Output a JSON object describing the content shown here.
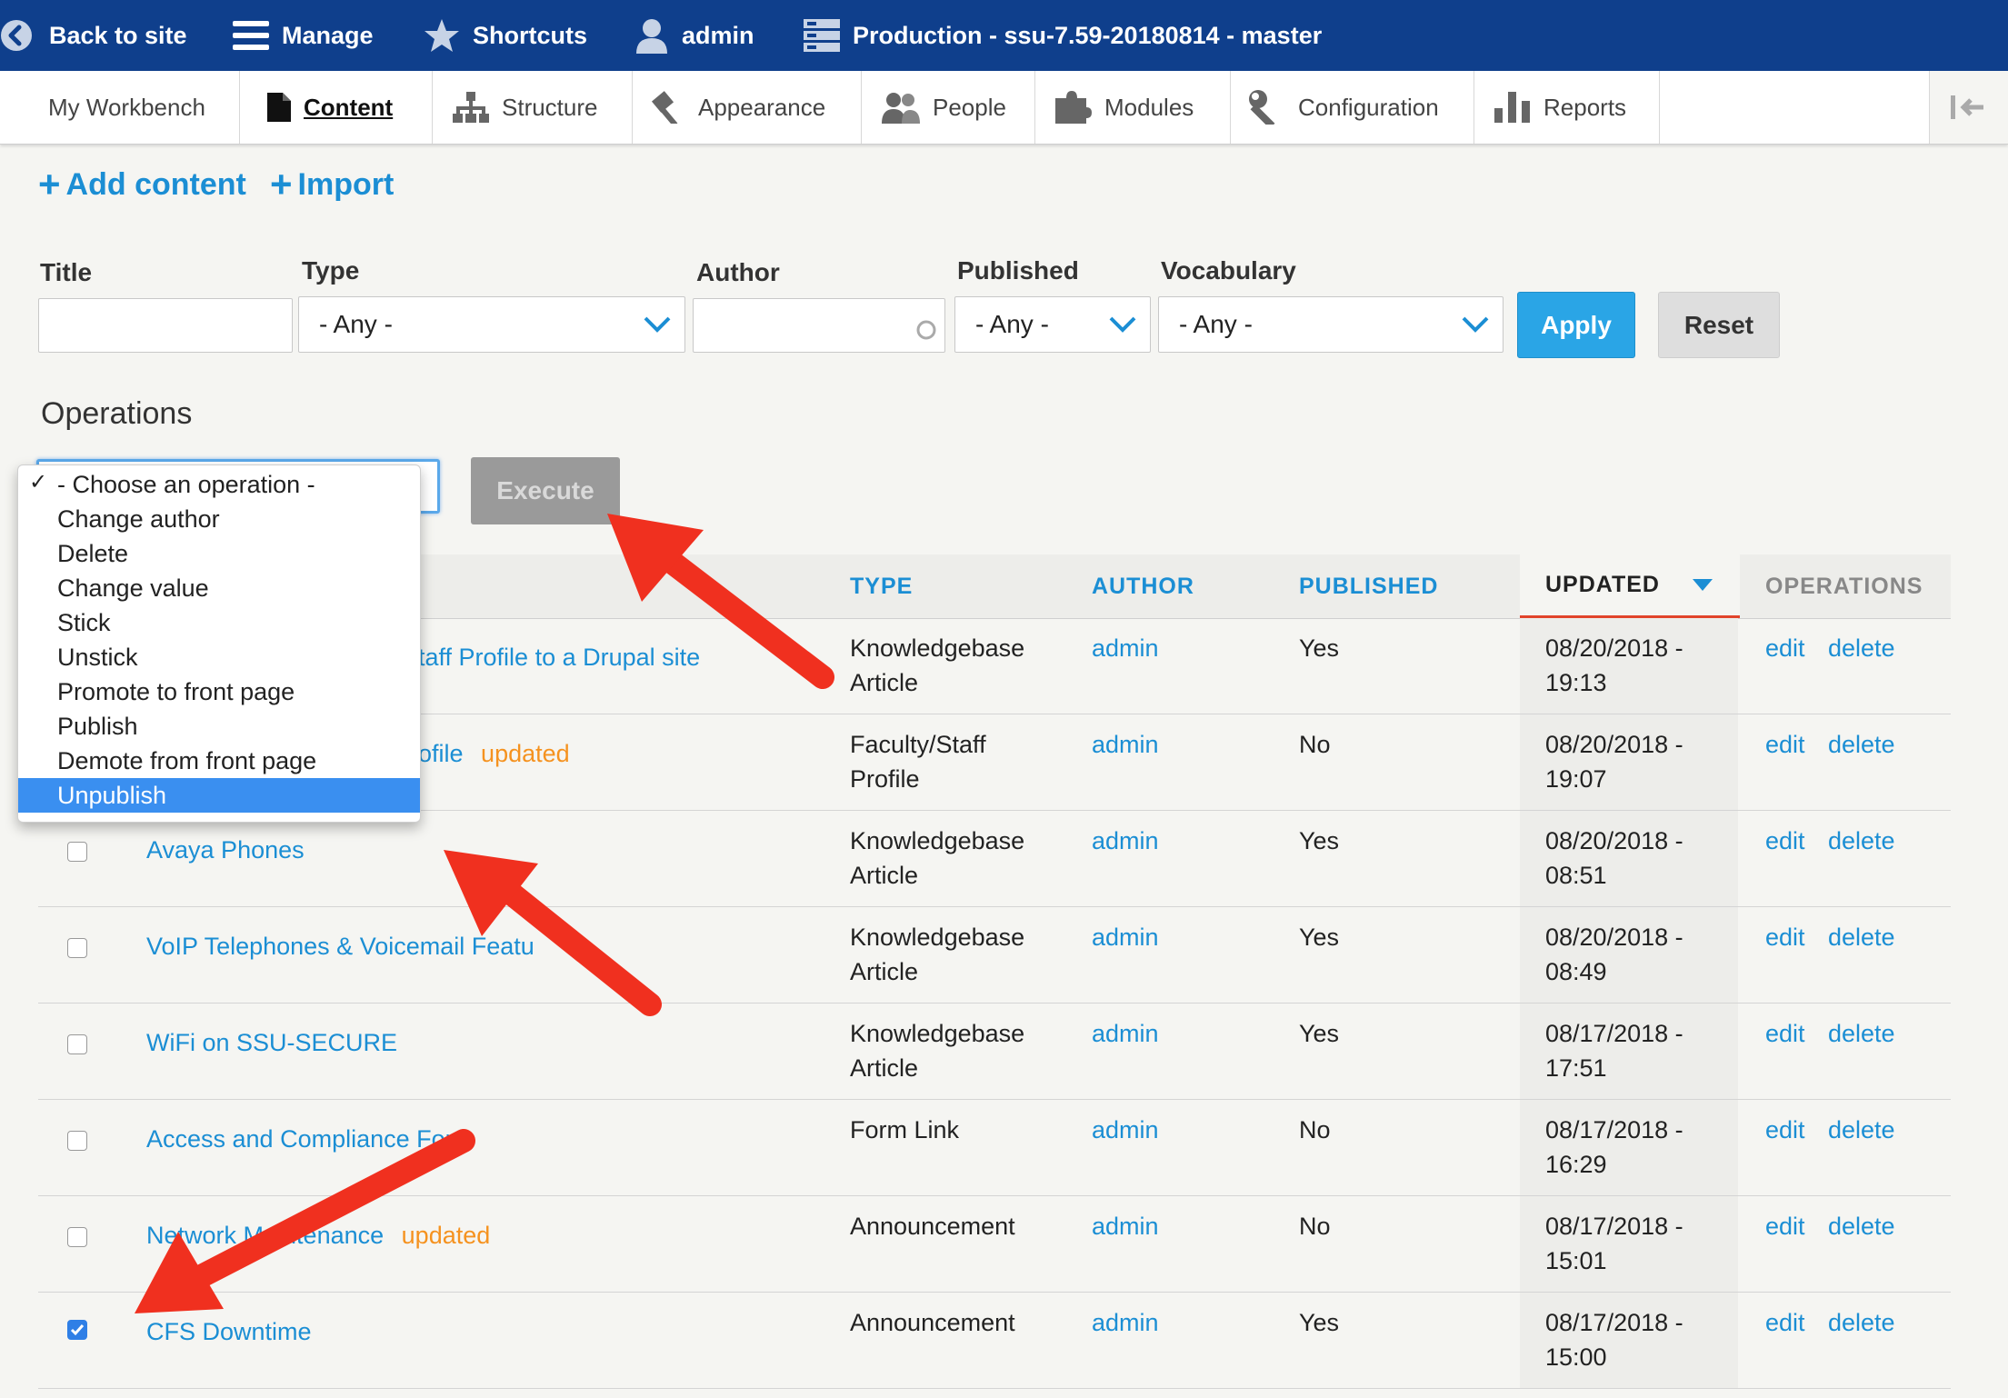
{
  "toolbar": {
    "back": "Back to site",
    "manage": "Manage",
    "shortcuts": "Shortcuts",
    "user": "admin",
    "environment": "Production - ssu-7.59-20180814 - master"
  },
  "tray": {
    "items": [
      {
        "label": "My Workbench",
        "icon": "none"
      },
      {
        "label": "Content",
        "icon": "document-icon",
        "active": true
      },
      {
        "label": "Structure",
        "icon": "sitemap-icon"
      },
      {
        "label": "Appearance",
        "icon": "brush-icon"
      },
      {
        "label": "People",
        "icon": "people-icon"
      },
      {
        "label": "Modules",
        "icon": "puzzle-icon"
      },
      {
        "label": "Configuration",
        "icon": "wrench-icon"
      },
      {
        "label": "Reports",
        "icon": "bar-chart-icon"
      }
    ]
  },
  "actions": {
    "add_content": "Add content",
    "import": "Import"
  },
  "filters": {
    "title_label": "Title",
    "type_label": "Type",
    "type_value": "- Any -",
    "author_label": "Author",
    "published_label": "Published",
    "published_value": "- Any -",
    "vocabulary_label": "Vocabulary",
    "vocabulary_value": "- Any -",
    "apply": "Apply",
    "reset": "Reset"
  },
  "operations": {
    "label": "Operations",
    "execute": "Execute",
    "options": [
      "- Choose an operation -",
      "Change author",
      "Delete",
      "Change value",
      "Stick",
      "Unstick",
      "Promote to front page",
      "Publish",
      "Demote from front page",
      "Unpublish"
    ],
    "checked_option": "- Choose an operation -",
    "highlighted_option": "Unpublish"
  },
  "table": {
    "headers": {
      "type": "TYPE",
      "author": "AUTHOR",
      "published": "PUBLISHED",
      "updated": "UPDATED",
      "operations": "OPERATIONS"
    },
    "rows": [
      {
        "title": "taff Profile to a Drupal site",
        "marker": "",
        "type1": "Knowledgebase",
        "type2": "Article",
        "author": "admin",
        "published": "Yes",
        "date": "08/20/2018 -",
        "time": "19:13",
        "edit": "edit",
        "delete": "delete",
        "checked": false
      },
      {
        "title": "ofile",
        "marker": "updated",
        "type1": "Faculty/Staff",
        "type2": "Profile",
        "author": "admin",
        "published": "No",
        "date": "08/20/2018 -",
        "time": "19:07",
        "edit": "edit",
        "delete": "delete",
        "checked": false
      },
      {
        "title": "Avaya Phones",
        "marker": "",
        "type1": "Knowledgebase",
        "type2": "Article",
        "author": "admin",
        "published": "Yes",
        "date": "08/20/2018 -",
        "time": "08:51",
        "edit": "edit",
        "delete": "delete",
        "checked": false
      },
      {
        "title": "VoIP Telephones & Voicemail Featu",
        "marker": "",
        "type1": "Knowledgebase",
        "type2": "Article",
        "author": "admin",
        "published": "Yes",
        "date": "08/20/2018 -",
        "time": "08:49",
        "edit": "edit",
        "delete": "delete",
        "checked": false
      },
      {
        "title": "WiFi on SSU-SECURE",
        "marker": "",
        "type1": "Knowledgebase",
        "type2": "Article",
        "author": "admin",
        "published": "Yes",
        "date": "08/17/2018 -",
        "time": "17:51",
        "edit": "edit",
        "delete": "delete",
        "checked": false
      },
      {
        "title": "Access and Compliance Form",
        "marker": "",
        "type1": "Form Link",
        "type2": "",
        "author": "admin",
        "published": "No",
        "date": "08/17/2018 -",
        "time": "16:29",
        "edit": "edit",
        "delete": "delete",
        "checked": false
      },
      {
        "title": "Network Maintenance",
        "marker": "updated",
        "type1": "Announcement",
        "type2": "",
        "author": "admin",
        "published": "No",
        "date": "08/17/2018 -",
        "time": "15:01",
        "edit": "edit",
        "delete": "delete",
        "checked": false
      },
      {
        "title": "CFS Downtime",
        "marker": "",
        "type1": "Announcement",
        "type2": "",
        "author": "admin",
        "published": "Yes",
        "date": "08/17/2018 -",
        "time": "15:00",
        "edit": "edit",
        "delete": "delete",
        "checked": true
      }
    ]
  },
  "colors": {
    "toolbar_bg": "#0f3f8c",
    "link": "#1b8ed4",
    "apply": "#2aa5e6",
    "active_sort": "#e1442b",
    "marker": "#f5921f",
    "annotation_arrow": "#f0301f"
  }
}
